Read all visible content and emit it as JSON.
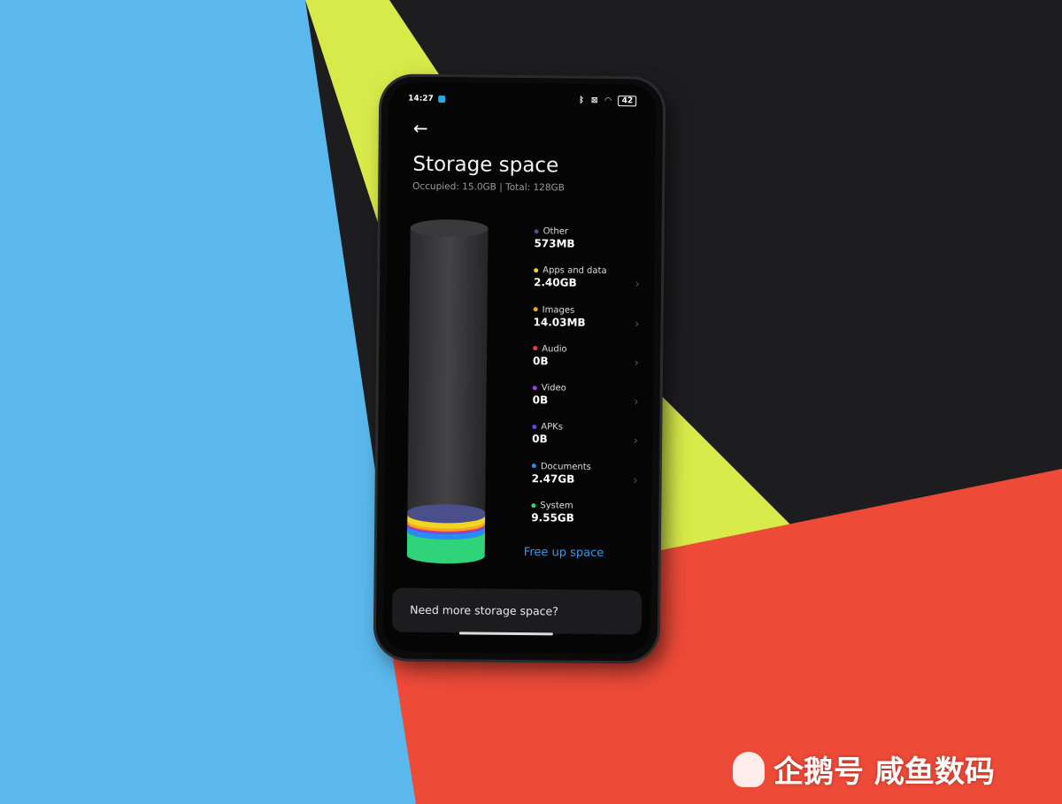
{
  "status_bar": {
    "time": "14:27",
    "icons": [
      "bluetooth-icon",
      "sim-icon",
      "wifi-icon",
      "battery-icon"
    ],
    "battery": "42"
  },
  "header": {
    "title": "Storage space",
    "subtitle": "Occupied: 15.0GB | Total: 128GB"
  },
  "categories": [
    {
      "label": "Other",
      "value": "573MB",
      "color": "#4a4f8a",
      "chevron": false
    },
    {
      "label": "Apps and data",
      "value": "2.40GB",
      "color": "#f2d521",
      "chevron": true
    },
    {
      "label": "Images",
      "value": "14.03MB",
      "color": "#f5a623",
      "chevron": true
    },
    {
      "label": "Audio",
      "value": "0B",
      "color": "#f03a4a",
      "chevron": true
    },
    {
      "label": "Video",
      "value": "0B",
      "color": "#a040e0",
      "chevron": true
    },
    {
      "label": "APKs",
      "value": "0B",
      "color": "#5a4af0",
      "chevron": true
    },
    {
      "label": "Documents",
      "value": "2.47GB",
      "color": "#2a8cf0",
      "chevron": true
    },
    {
      "label": "System",
      "value": "9.55GB",
      "color": "#2fd47a",
      "chevron": false
    }
  ],
  "usage_fraction": 0.117,
  "free_up_label": "Free up space",
  "more_storage_label": "Need more storage space?",
  "watermark": "企鹅号 咸鱼数码",
  "colors": {
    "accent": "#2e9bf0",
    "bg_blue": "#5ab8ec",
    "bg_yellow": "#d8ea4a",
    "bg_red": "#ee4a38",
    "bg_black": "#1d1d1f"
  }
}
